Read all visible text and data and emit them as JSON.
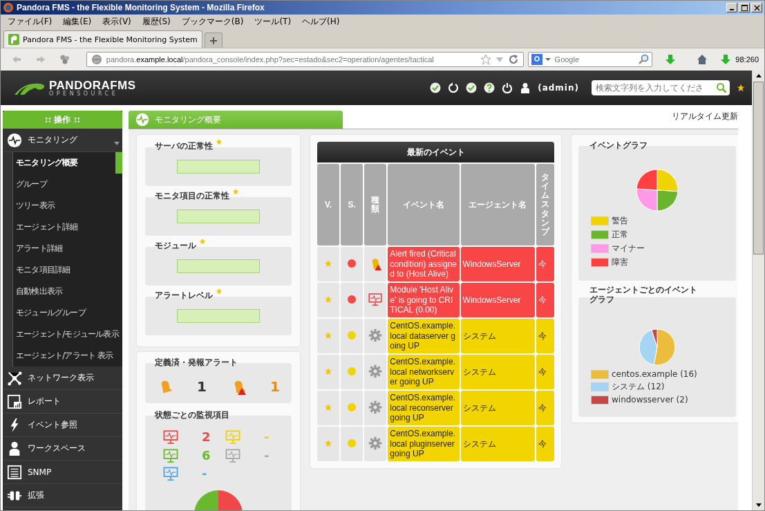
{
  "window": {
    "title": "Pandora FMS - the Flexible Monitoring System - Mozilla Firefox"
  },
  "menu": [
    "ファイル(F)",
    "編集(E)",
    "表示(V)",
    "履歴(S)",
    "ブックマーク(B)",
    "ツール(T)",
    "ヘルプ(H)"
  ],
  "tabs": [
    {
      "label": "Pandora FMS - the Flexible Monitoring System",
      "selected": true
    }
  ],
  "address": {
    "prefix": "pandora.",
    "host": "example.local",
    "path": "/pandora_console/index.php?sec=estado&sec2=operation/agentes/tactical"
  },
  "web_search": {
    "placeholder": "Google"
  },
  "counter": "98:260",
  "header": {
    "logo": "PANDORAFMS",
    "logo_sub": "OPENSOURCE",
    "user": "(admin)",
    "search_placeholder": "検索文字列を入力してくださ"
  },
  "sidebar": {
    "heading": ":: 操作 ::",
    "sections": [
      {
        "label": "モニタリング",
        "kind": "pulse",
        "expanded": true,
        "children": [
          {
            "label": "モニタリング概要",
            "selected": true
          },
          {
            "label": "グループ",
            "selected": false
          },
          {
            "label": "ツリー表示",
            "selected": false
          },
          {
            "label": "エージェント詳細",
            "selected": false
          },
          {
            "label": "アラート詳細",
            "selected": false
          },
          {
            "label": "モニタ項目詳細",
            "selected": false
          },
          {
            "label": "自動検出表示",
            "selected": false
          },
          {
            "label": "モジュールグループ",
            "selected": false
          },
          {
            "label": "エージェント/モジュール表示",
            "selected": false
          },
          {
            "label": "エージェント/アラート 表示",
            "selected": false
          }
        ]
      },
      {
        "label": "ネットワーク表示",
        "kind": "network",
        "expanded": false
      },
      {
        "label": "レポート",
        "kind": "report",
        "expanded": false
      },
      {
        "label": "イベント参照",
        "kind": "bolt",
        "expanded": false
      },
      {
        "label": "ワークスペース",
        "kind": "person",
        "expanded": false
      },
      {
        "label": "SNMP",
        "kind": "list",
        "expanded": false
      },
      {
        "label": "拡張",
        "kind": "plug",
        "expanded": false
      }
    ]
  },
  "page": {
    "title": "モニタリング概要",
    "realtime": "リアルタイム更新"
  },
  "health": [
    {
      "label": "サーバの正常性"
    },
    {
      "label": "モニタ項目の正常性"
    },
    {
      "label": "モジュール"
    },
    {
      "label": "アラートレベル"
    }
  ],
  "alerts": {
    "title": "定義済・発報アラート",
    "defined": "1",
    "fired": "1"
  },
  "monitors": {
    "title": "状態ごとの監視項目",
    "items": [
      {
        "color": "#f04848",
        "count": "2"
      },
      {
        "color": "#f0d000",
        "count": "-"
      },
      {
        "color": "#6ab82e",
        "count": "6"
      },
      {
        "color": "#a8a8a8",
        "count": "-"
      },
      {
        "color": "#4aa8e8",
        "count": "-"
      }
    ]
  },
  "events": {
    "title": "最新のイベント",
    "columns": [
      "V.",
      "S.",
      "種類",
      "イベント名",
      "エージェント名",
      "タイムスタンプ"
    ],
    "rows": [
      {
        "color": "#f84646",
        "kind": "alert",
        "event": "Alert fired (Critical condition) assigned to (Host Alive)",
        "agent": "WindowsServer",
        "time": "今"
      },
      {
        "color": "#f84646",
        "kind": "monitor",
        "event": "Module 'Host Alive' is going to CRITICAL (0.00)",
        "agent": "WindowsServer",
        "time": "今"
      },
      {
        "color": "#f2d400",
        "kind": "system",
        "event": "CentOS.example.local dataserver going UP",
        "agent": "システム",
        "time": "今"
      },
      {
        "color": "#f2d400",
        "kind": "system",
        "event": "CentOS.example.local networkserver going UP",
        "agent": "システム",
        "time": "今"
      },
      {
        "color": "#f2d400",
        "kind": "system",
        "event": "CentOS.example.local reconserver going UP",
        "agent": "システム",
        "time": "今"
      },
      {
        "color": "#f2d400",
        "kind": "system",
        "event": "CentOS.example.local pluginserver going UP",
        "agent": "システム",
        "time": "今"
      }
    ]
  },
  "event_graph": {
    "title": "イベントグラフ",
    "legend": [
      {
        "label": "警告",
        "color": "#f0d400"
      },
      {
        "label": "正常",
        "color": "#6ab42e"
      },
      {
        "label": "マイナー",
        "color": "#ff99e8"
      },
      {
        "label": "障害",
        "color": "#ff4040"
      }
    ]
  },
  "agent_graph": {
    "title": "エージェントごとのイベントグラフ",
    "legend": [
      {
        "label": "centos.example (16)",
        "color": "#ecbc3c"
      },
      {
        "label": "システム (12)",
        "color": "#a8d4f4"
      },
      {
        "label": "windowsserver (2)",
        "color": "#c84646"
      }
    ]
  }
}
